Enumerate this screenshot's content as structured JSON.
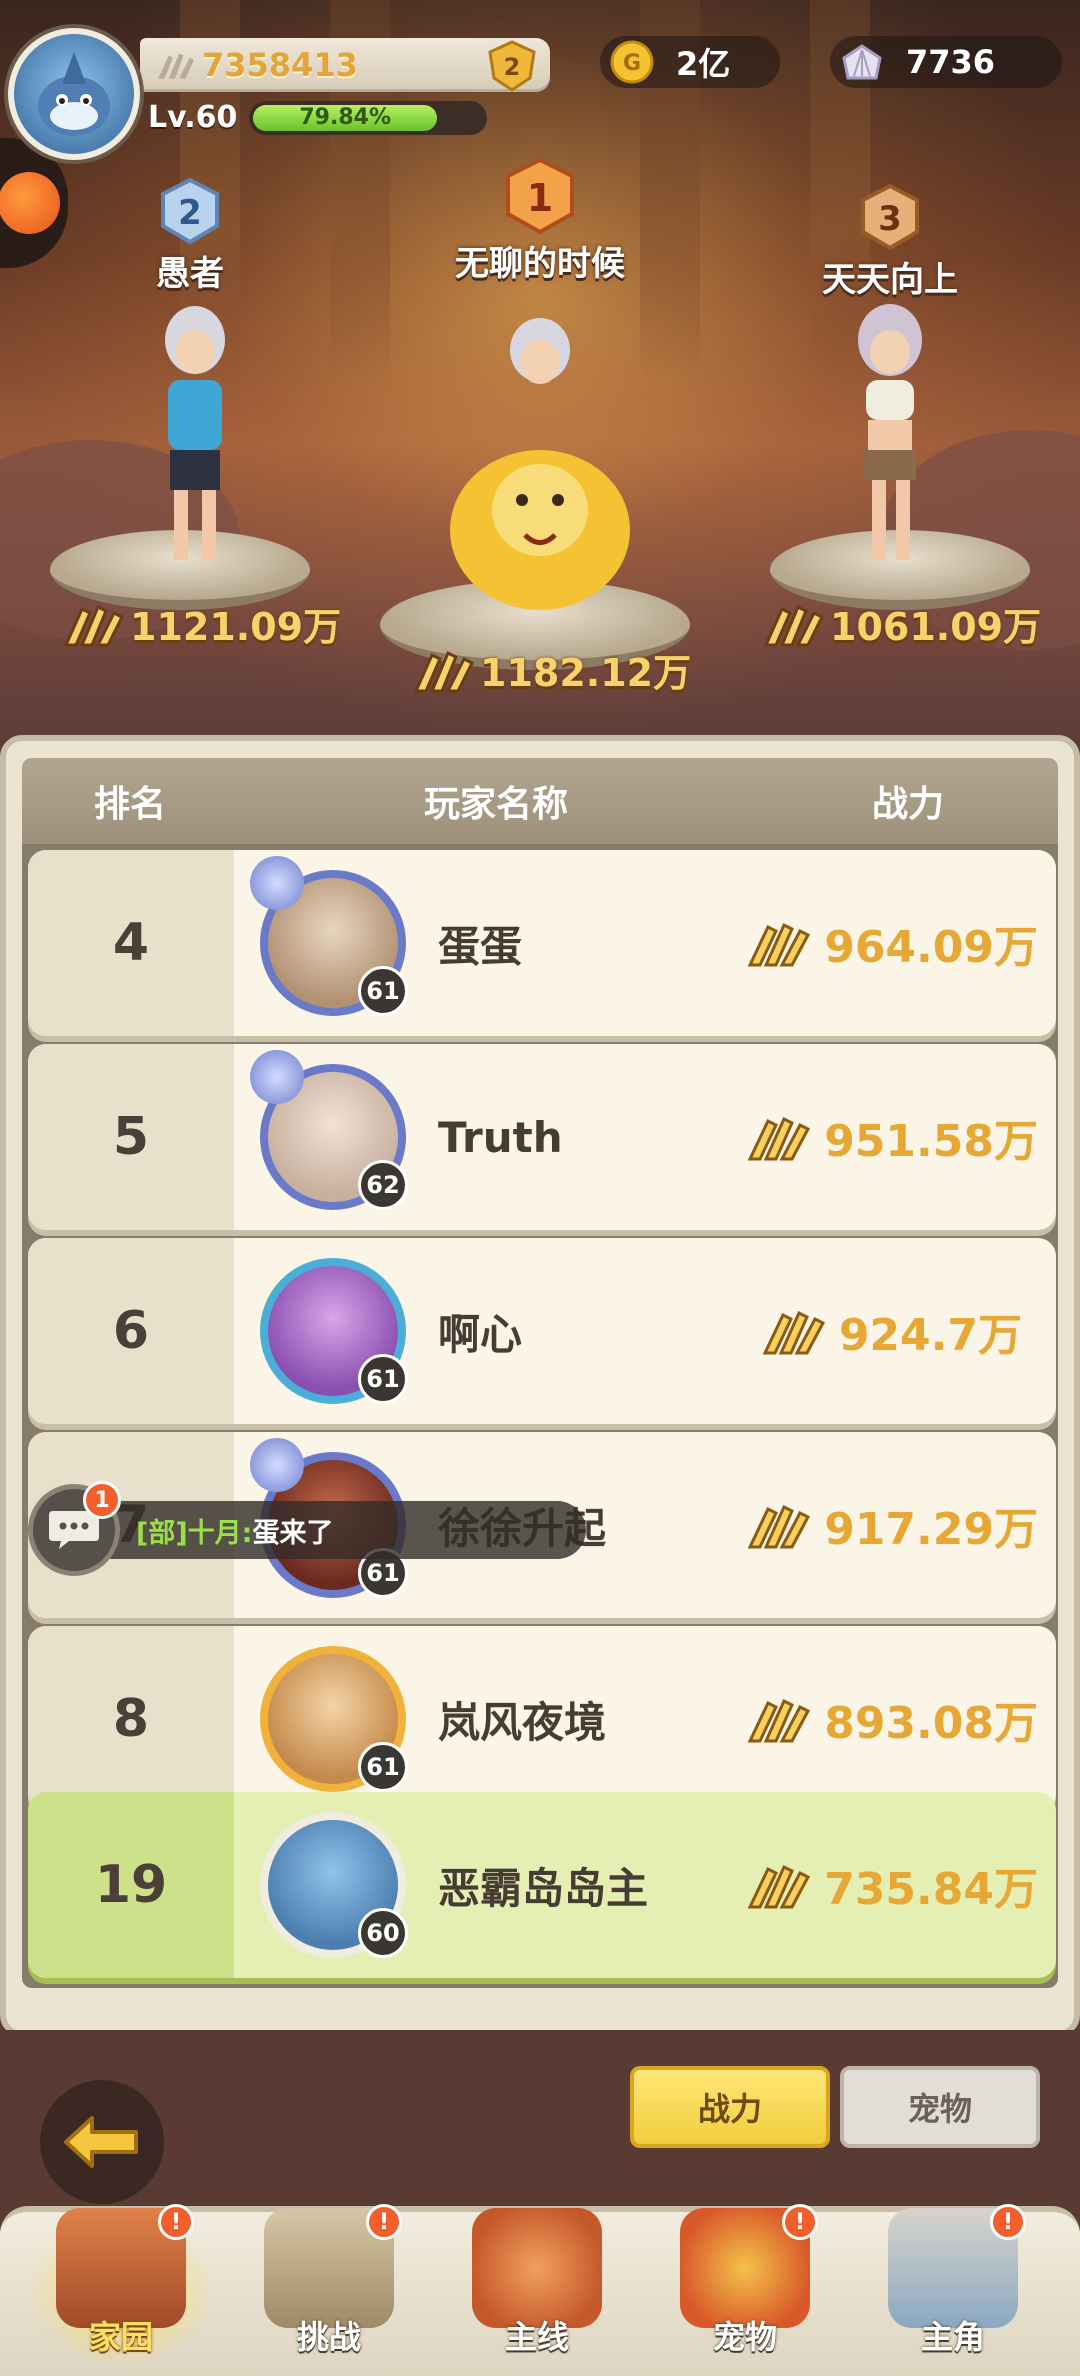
{
  "hud": {
    "score": "7358413",
    "rank_badge": "2",
    "level": "Lv.60",
    "exp_percent": "79.84%",
    "exp_fraction": 0.7984,
    "gold": "2亿",
    "shells": "7736"
  },
  "podium": [
    {
      "rank": "2",
      "name": "愚者",
      "power": "1121.09万"
    },
    {
      "rank": "1",
      "name": "无聊的时候",
      "power": "1182.12万"
    },
    {
      "rank": "3",
      "name": "天天向上",
      "power": "1061.09万"
    }
  ],
  "table": {
    "col_rank": "排名",
    "col_name": "玩家名称",
    "col_power": "战力",
    "rows": [
      {
        "rank": "4",
        "name": "蛋蛋",
        "level": "61",
        "power": "964.09万"
      },
      {
        "rank": "5",
        "name": "Truth",
        "level": "62",
        "power": "951.58万"
      },
      {
        "rank": "6",
        "name": "啊心",
        "level": "61",
        "power": "924.7万"
      },
      {
        "rank": "7",
        "name": "徐徐升起",
        "level": "61",
        "power": "917.29万"
      },
      {
        "rank": "8",
        "name": "岚风夜境",
        "level": "61",
        "power": "893.08万"
      }
    ],
    "mine": {
      "rank": "19",
      "name": "恶霸岛岛主",
      "level": "60",
      "power": "735.84万"
    }
  },
  "chat": {
    "unread": "1",
    "channel": "[部]十月:",
    "message": "蛋来了"
  },
  "tabs": {
    "active": "战力",
    "inactive": "宠物"
  },
  "nav": [
    {
      "label": "家园",
      "badge": "!"
    },
    {
      "label": "挑战",
      "badge": "!"
    },
    {
      "label": "主线",
      "badge": ""
    },
    {
      "label": "宠物",
      "badge": "!"
    },
    {
      "label": "主角",
      "badge": "!"
    }
  ],
  "colors": {
    "power_gold": "#e6a734",
    "my_row_bg": "#e5efb4",
    "active_tab": "#f3cc3c"
  }
}
